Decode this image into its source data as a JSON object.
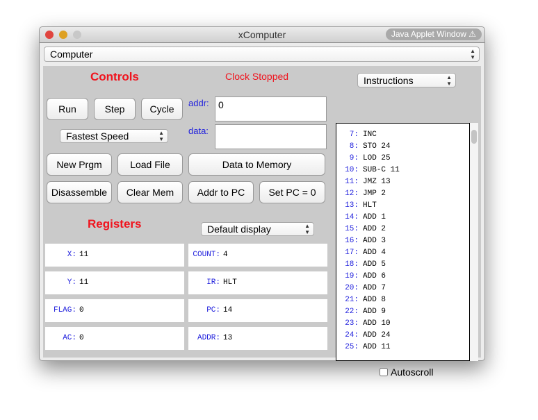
{
  "window": {
    "title": "xComputer",
    "applet_badge": "Java Applet Window ⚠"
  },
  "top_select": "Computer",
  "controls_title": "Controls",
  "clock_status": "Clock Stopped",
  "buttons": {
    "run": "Run",
    "step": "Step",
    "cycle": "Cycle",
    "new_prgm": "New Prgm",
    "load_file": "Load File",
    "data_to_memory": "Data to Memory",
    "disassemble": "Disassemble",
    "clear_mem": "Clear Mem",
    "addr_to_pc": "Addr to PC",
    "set_pc": "Set PC = 0"
  },
  "speed_select": "Fastest Speed",
  "addr": {
    "label": "addr:",
    "value": "0"
  },
  "data": {
    "label": "data:",
    "value": ""
  },
  "registers_title": "Registers",
  "display_select": "Default display",
  "registers": [
    {
      "name": "X:",
      "value": "11"
    },
    {
      "name": "COUNT:",
      "value": "4"
    },
    {
      "name": "Y:",
      "value": "11"
    },
    {
      "name": "IR:",
      "value": "HLT"
    },
    {
      "name": "FLAG:",
      "value": "0"
    },
    {
      "name": "PC:",
      "value": "14"
    },
    {
      "name": "AC:",
      "value": "0"
    },
    {
      "name": "ADDR:",
      "value": "13"
    }
  ],
  "view_select": "Instructions",
  "instructions": [
    {
      "n": "7:",
      "op": "INC"
    },
    {
      "n": "8:",
      "op": "STO 24"
    },
    {
      "n": "9:",
      "op": "LOD 25"
    },
    {
      "n": "10:",
      "op": "SUB-C 11"
    },
    {
      "n": "11:",
      "op": "JMZ 13"
    },
    {
      "n": "12:",
      "op": "JMP 2"
    },
    {
      "n": "13:",
      "op": "HLT"
    },
    {
      "n": "14:",
      "op": "ADD 1"
    },
    {
      "n": "15:",
      "op": "ADD 2"
    },
    {
      "n": "16:",
      "op": "ADD 3"
    },
    {
      "n": "17:",
      "op": "ADD 4"
    },
    {
      "n": "18:",
      "op": "ADD 5"
    },
    {
      "n": "19:",
      "op": "ADD 6"
    },
    {
      "n": "20:",
      "op": "ADD 7"
    },
    {
      "n": "21:",
      "op": "ADD 8"
    },
    {
      "n": "22:",
      "op": "ADD 9"
    },
    {
      "n": "23:",
      "op": "ADD 10"
    },
    {
      "n": "24:",
      "op": "ADD 24"
    },
    {
      "n": "25:",
      "op": "ADD 11"
    }
  ],
  "autoscroll": {
    "label": "Autoscroll",
    "checked": false
  }
}
